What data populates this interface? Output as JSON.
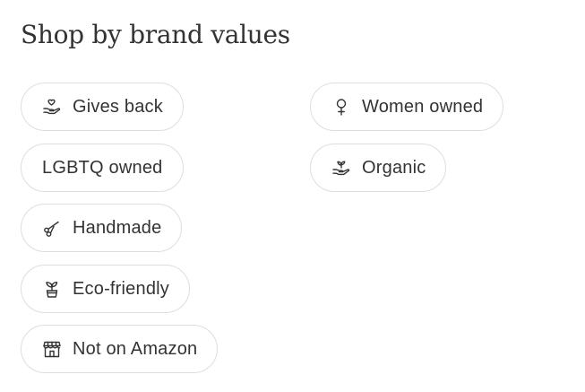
{
  "section": {
    "title": "Shop by brand values"
  },
  "pills": {
    "gives_back": {
      "label": "Gives back",
      "icon": "hand-heart-icon"
    },
    "women_owned": {
      "label": "Women owned",
      "icon": "female-symbol-icon"
    },
    "lgbtq_owned": {
      "label": "LGBTQ owned"
    },
    "organic": {
      "label": "Organic",
      "icon": "hand-sprout-icon"
    },
    "handmade": {
      "label": "Handmade",
      "icon": "scissors-icon"
    },
    "eco_friendly": {
      "label": "Eco-friendly",
      "icon": "potted-plant-icon"
    },
    "not_on_amazon": {
      "label": "Not on Amazon",
      "icon": "storefront-icon"
    }
  }
}
